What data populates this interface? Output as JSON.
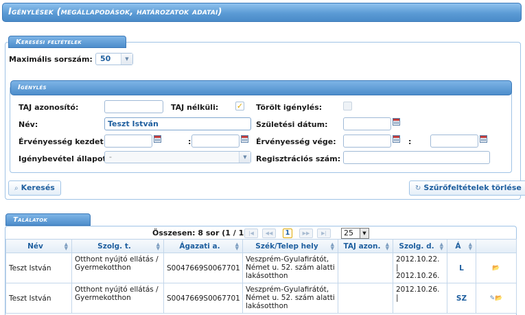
{
  "page": {
    "title": "Igénylések (megállapodások, határozatok adatai)"
  },
  "search_panel": {
    "tab_label": "Keresési feltételek",
    "max_row_label": "Maximális sorszám:",
    "max_row_value": "50"
  },
  "request_panel": {
    "tab_label": "Igénylés",
    "taj_label": "TAJ azonosító:",
    "taj_value": "",
    "taj_missing_label": "TAJ nélküli:",
    "deleted_label": "Törölt igénylés:",
    "name_label": "Név:",
    "name_value": "Teszt István",
    "birth_label": "Születési dátum:",
    "valid_from_label": "Érvényesség kezdet:",
    "valid_to_label": "Érvényesség vége:",
    "range_sep": ":",
    "status_label": "Igénybevétel állapota:",
    "status_value": "-",
    "reg_label": "Regisztrációs szám:"
  },
  "buttons": {
    "search": "Keresés",
    "clear": "Szűrőfeltételek törlése"
  },
  "results": {
    "tab_label": "Találatok",
    "summary": "Összesen: 8 sor (1 / 1)",
    "current_page": "1",
    "page_size": "25",
    "columns": [
      "Név",
      "Szolg. t.",
      "Ágazati a.",
      "Szék/Telep hely",
      "TAJ azon.",
      "Szolg. d.",
      "Á",
      ""
    ],
    "rows": [
      {
        "name": "Teszt István",
        "service": "Otthont nyújtó ellátás / Gyermekotthon",
        "sector": "S0047669S0067701",
        "location": "Veszprém-Gyulafirátót, Német u. 52. szám alatti lakásotthon",
        "taj": "",
        "dates": "2012.10.22. | 2012.10.26.",
        "status": "L"
      },
      {
        "name": "Teszt István",
        "service": "Otthont nyújtó ellátás / Gyermekotthon",
        "sector": "S0047669S0067701",
        "location": "Veszprém-Gyulafirátót, Német u. 52. szám alatti lakásotthon",
        "taj": "",
        "dates": "2012.10.26. |",
        "status": "SZ"
      }
    ]
  }
}
